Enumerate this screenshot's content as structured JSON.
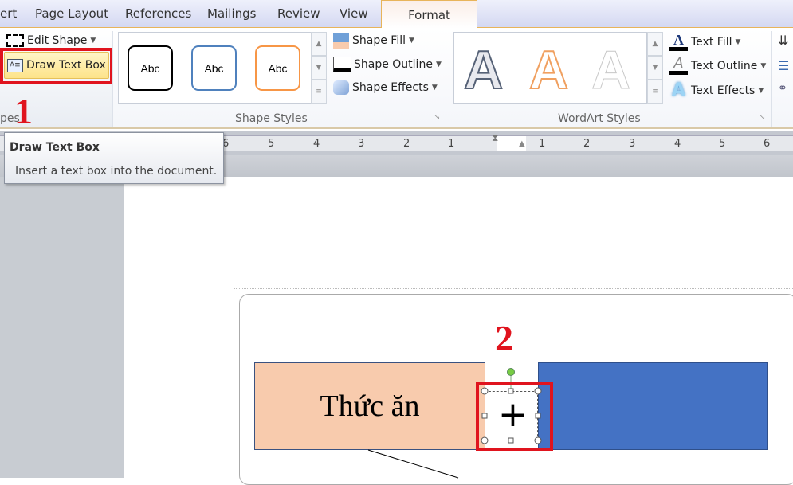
{
  "tabs": [
    "ert",
    "Page Layout",
    "References",
    "Mailings",
    "Review",
    "View",
    "Format"
  ],
  "active_tab": "Format",
  "ribbon": {
    "insert_shapes": {
      "edit_shape": "Edit Shape",
      "draw_text_box": "Draw Text Box",
      "label": "pes"
    },
    "shape_styles": {
      "samples": [
        "Abc",
        "Abc",
        "Abc"
      ],
      "sample_colors": [
        "#000000",
        "#4f81bd",
        "#f79646"
      ],
      "shape_fill": "Shape Fill",
      "shape_outline": "Shape Outline",
      "shape_effects": "Shape Effects",
      "label": "Shape Styles"
    },
    "wordart_styles": {
      "samples": [
        "A",
        "A",
        "A"
      ],
      "text_fill": "Text Fill",
      "text_outline": "Text Outline",
      "text_effects": "Text Effects",
      "label": "WordArt Styles"
    }
  },
  "ruler": {
    "left": [
      "6",
      "5",
      "4",
      "3",
      "2",
      "1"
    ],
    "right": [
      "1",
      "2",
      "3",
      "4",
      "5",
      "6"
    ]
  },
  "tooltip": {
    "title": "Draw Text Box",
    "description": "Insert a text box into the document."
  },
  "annotations": {
    "step1": "1",
    "step2": "2",
    "color": "#e0141e"
  },
  "document": {
    "shape_left_text": "Thức ăn",
    "shape_left_color": "#f8cbad",
    "shape_right_color": "#4472c4"
  }
}
